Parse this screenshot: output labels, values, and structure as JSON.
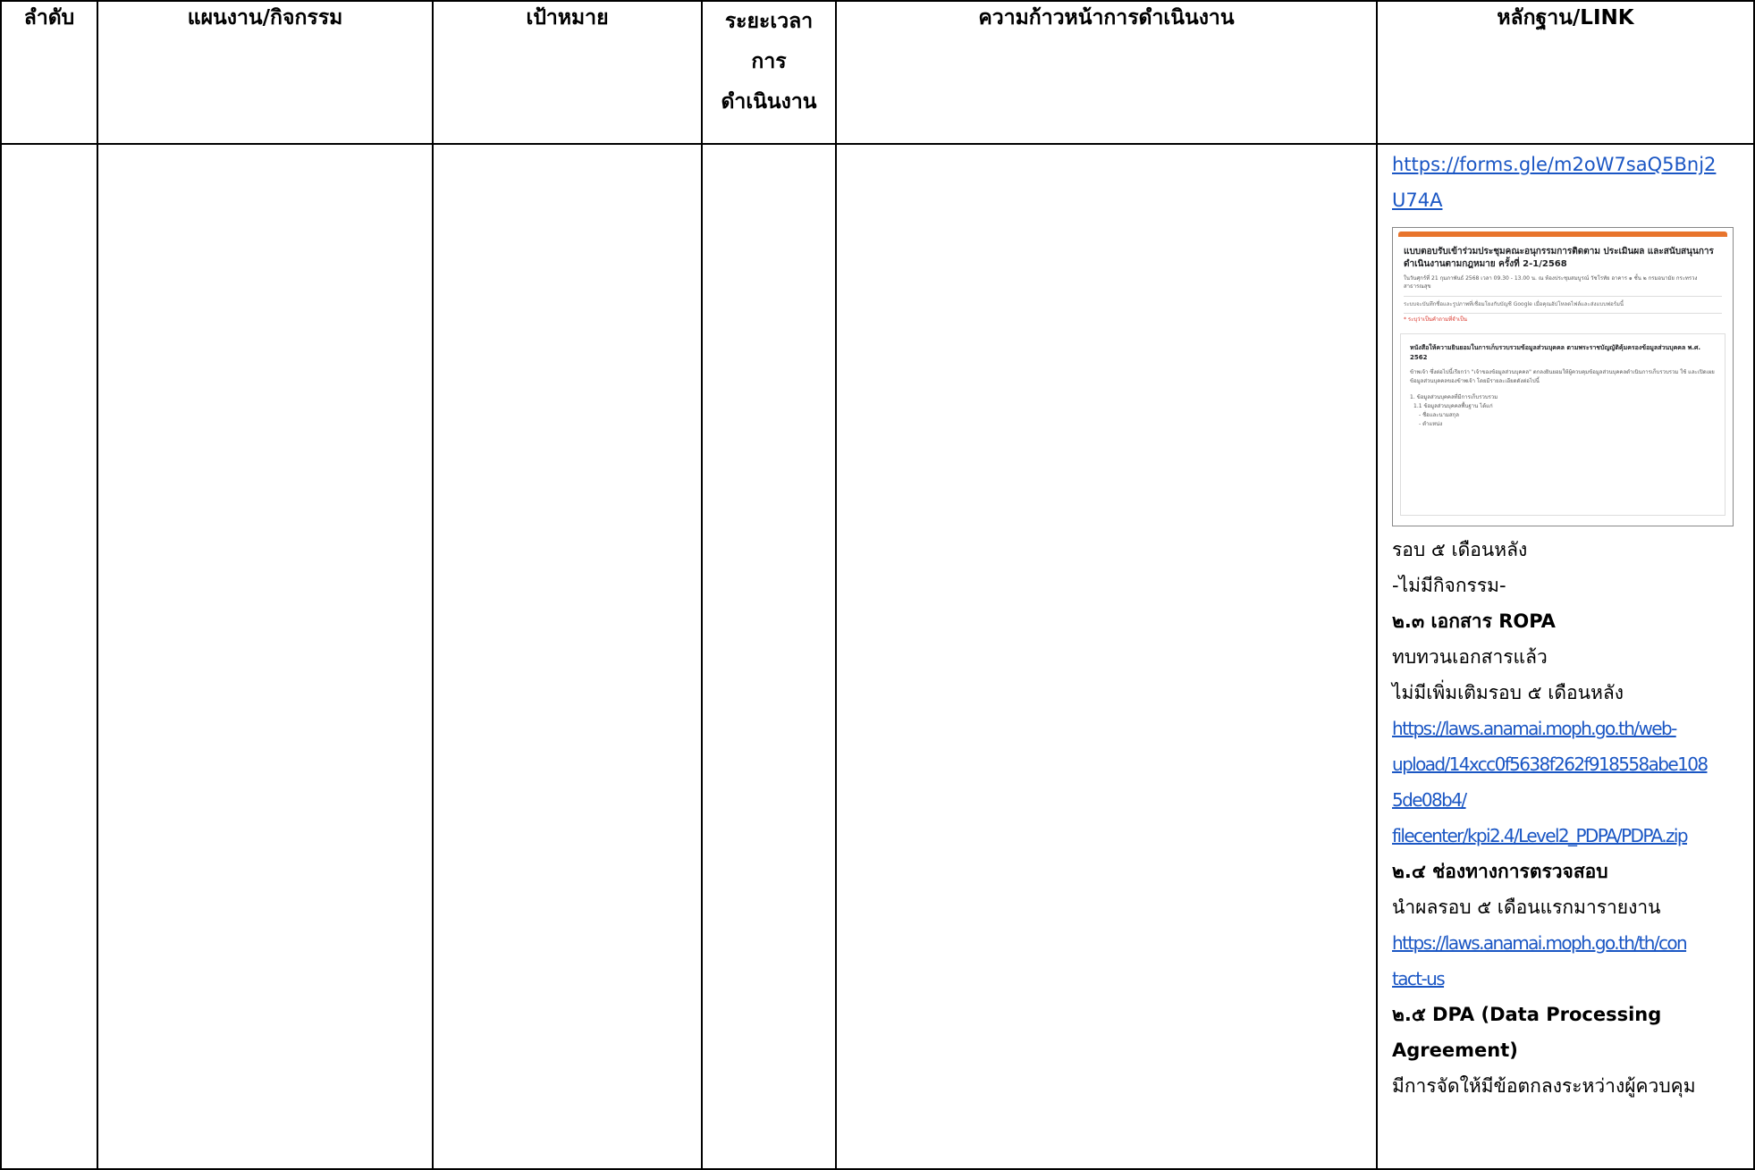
{
  "headers": {
    "order": "ลำดับ",
    "plan": "แผนงาน/กิจกรรม",
    "target": "เป้าหมาย",
    "period_l1": "ระยะเวลา",
    "period_l2": "การ",
    "period_l3": "ดำเนินงาน",
    "progress": "ความก้าวหน้าการดำเนินงาน",
    "evidence": "หลักฐาน/LINK"
  },
  "evidence": {
    "form_link_l1": "https://forms.gle/m2oW7saQ5Bnj2",
    "form_link_l2": "U74A",
    "screenshot": {
      "title": "แบบตอบรับเข้าร่วมประชุมคณะอนุกรรมการติดตาม ประเมินผล และสนับสนุนการดำเนินงานตามกฎหมาย ครั้งที่ 2-1/2568",
      "meta": "ในวันศุกร์ที่ 21 กุมภาพันธ์ 2568 เวลา 09.30 - 13.00 น. ณ ห้องประชุมสมบูรณ์ วัชโรทัย อาคาร ๑ ชั้น ๒ กรมอนามัย กระทรวงสาธารณสุข",
      "signin": "ระบบจะบันทึกชื่อและรูปภาพที่เชื่อมโยงกับบัญชี Google เมื่อคุณอัปโหลดไฟล์และส่งแบบฟอร์มนี้",
      "required": "* ระบุว่าเป็นคำถามที่จำเป็น",
      "card_title": "หนังสือให้ความยินยอมในการเก็บรวบรวมข้อมูลส่วนบุคคล ตามพระราชบัญญัติคุ้มครองข้อมูลส่วนบุคคล พ.ศ. 2562",
      "card_text": "ข้าพเจ้า ซึ่งต่อไปนี้เรียกว่า \"เจ้าของข้อมูลส่วนบุคคล\" ตกลงยินยอมให้ผู้ควบคุมข้อมูลส่วนบุคคลดำเนินการเก็บรวบรวม ใช้ และเปิดเผยข้อมูลส่วนบุคคลของข้าพเจ้า โดยมีรายละเอียดดังต่อไปนี้",
      "list1": "1. ข้อมูลส่วนบุคคลที่มีการเก็บรวบรวม",
      "list2": "1.1 ข้อมูลส่วนบุคคลพื้นฐาน ได้แก่",
      "list3": "- ชื่อและนามสกุล",
      "list4": "- ตำแหน่ง"
    },
    "round5": "รอบ ๕ เดือนหลัง",
    "no_activity": "-ไม่มีกิจกรรม-",
    "h23": "๒.๓ เอกสาร ROPA",
    "reviewed": "ทบทวนเอกสารแล้ว",
    "no_more": "ไม่มีเพิ่มเติมรอบ ๕ เดือนหลัง",
    "ropa_l1": "https://laws.anamai.moph.go.th/web-",
    "ropa_l2": "upload/14xcc0f5638f262f918558abe108",
    "ropa_l3": "5de08b4/",
    "ropa_l4": "filecenter/kpi2.4/Level2_PDPA/PDPA.zip",
    "h24": "๒.๔ ช่องทางการตรวจสอบ",
    "report_first": "นำผลรอบ ๕ เดือนแรกมารายงาน",
    "contact_l1": "https://laws.anamai.moph.go.th/th/con",
    "contact_l2": "tact-us",
    "h25_l1": "๒.๕ DPA (Data Processing",
    "h25_l2": "Agreement)",
    "dpa_text": "มีการจัดให้มีข้อตกลงระหว่างผู้ควบคุม"
  }
}
